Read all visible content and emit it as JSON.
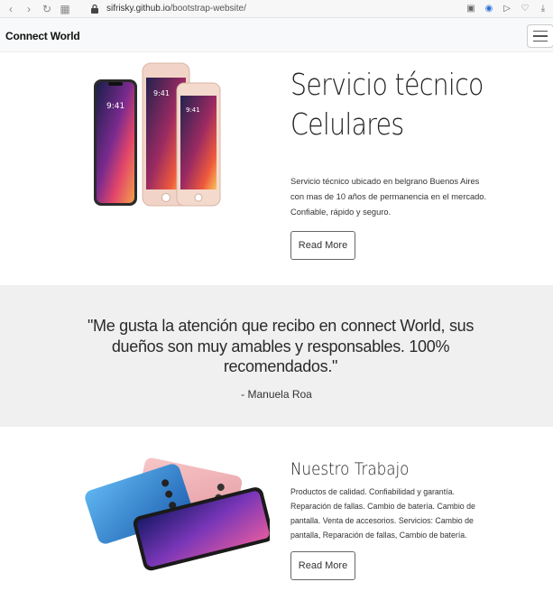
{
  "browser": {
    "url_domain": "sifrisky.github.io",
    "url_path": "/bootstrap-website/"
  },
  "navbar": {
    "brand": "Connect World"
  },
  "hero": {
    "title_line1": "Servicio técnico",
    "title_line2": "Celulares",
    "description": "Servicio técnico ubicado en belgrano Buenos Aires con mas de 10 años de permanencia en el mercado. Confiable, rápido y seguro.",
    "button_label": "Read More"
  },
  "testimonial": {
    "quote": "\"Me gusta la atención que recibo en connect World, sus dueños son muy amables y responsables. 100% recomendados.\"",
    "author": "- Manuela Roa"
  },
  "work": {
    "title": "Nuestro Trabajo",
    "description": "Productos de calidad. Confiabilidad y garantía. Reparación de fallas. Cambio de batería. Cambio de pantalla. Venta de accesorios. Servicios: Cambio de pantalla, Reparación de fallas, Cambio de batería.",
    "button_label": "Read More"
  },
  "colors": {
    "quote_band": "#f0f0f0",
    "navbar_bg": "#f8f9fa"
  }
}
